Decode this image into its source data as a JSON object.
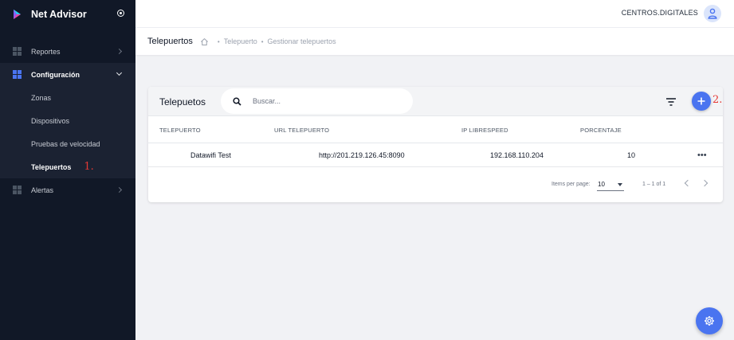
{
  "app": {
    "name": "Net Advisor"
  },
  "sidebar": {
    "items": [
      {
        "label": "Reportes"
      },
      {
        "label": "Configuración"
      },
      {
        "label": "Alertas"
      }
    ],
    "subitems": [
      {
        "label": "Zonas"
      },
      {
        "label": "Dispositivos"
      },
      {
        "label": "Pruebas de velocidad"
      },
      {
        "label": "Telepuertos"
      }
    ],
    "annotation": "1."
  },
  "header": {
    "user": "CENTROS.DIGITALES"
  },
  "breadcrumb": {
    "title": "Telepuertos",
    "links": [
      "Telepuerto",
      "Gestionar telepuertos"
    ]
  },
  "card": {
    "title": "Telepuetos",
    "search_placeholder": "Buscar...",
    "add_annotation": "2.",
    "columns": [
      "TELEPUERTO",
      "URL TELEPUERTO",
      "IP LIBRESPEED",
      "PORCENTAJE"
    ],
    "rows": [
      {
        "telepuerto": "Datawifi Test",
        "url": "http://201.219.126.45:8090",
        "ip": "192.168.110.204",
        "porcentaje": "10",
        "actions": "•••"
      }
    ],
    "paginator": {
      "items_per_page_label": "Items per page:",
      "items_per_page": "10",
      "range": "1 – 1 of 1"
    }
  },
  "colors": {
    "accent": "#4a74f0",
    "sidebar_bg": "#111827",
    "annotation": "#e53935"
  },
  "icons": [
    "logo-icon",
    "toggle-icon",
    "dashboard-icon",
    "chevron-icon",
    "user-icon",
    "home-icon",
    "search-icon",
    "filter-icon",
    "plus-icon",
    "more-icon",
    "settings-icon"
  ]
}
